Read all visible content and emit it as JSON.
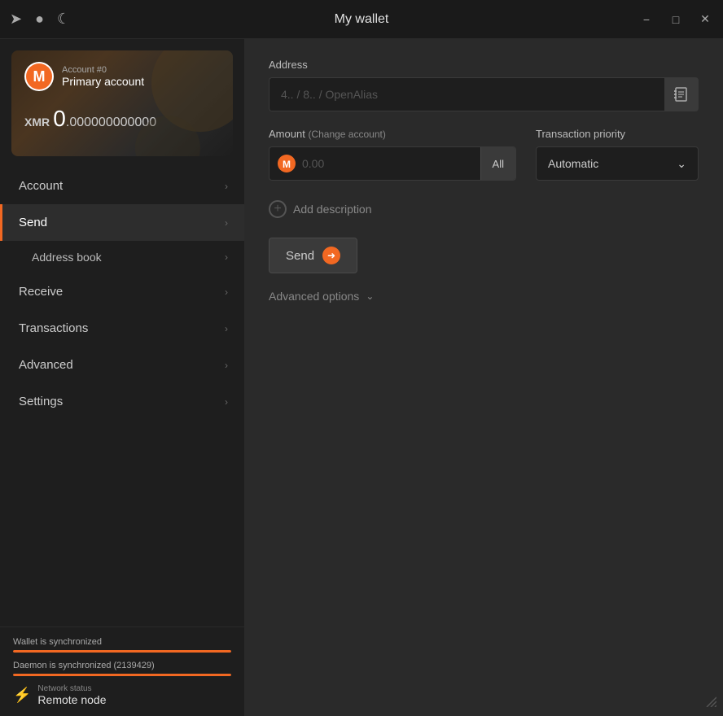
{
  "titlebar": {
    "title": "My wallet",
    "icon_forward": "→",
    "icon_globe": "🌐",
    "icon_moon": "🌙",
    "min_label": "−",
    "max_label": "□",
    "close_label": "✕"
  },
  "account_card": {
    "account_number": "Account #0",
    "account_name": "Primary account",
    "balance_label": "XMR",
    "balance_whole": "0",
    "balance_decimals": ".000000000000"
  },
  "nav": {
    "items": [
      {
        "label": "Account",
        "active": false,
        "sub": []
      },
      {
        "label": "Send",
        "active": true,
        "sub": [
          {
            "label": "Address book"
          }
        ]
      },
      {
        "label": "Receive",
        "active": false,
        "sub": []
      },
      {
        "label": "Transactions",
        "active": false,
        "sub": []
      },
      {
        "label": "Advanced",
        "active": false,
        "sub": []
      },
      {
        "label": "Settings",
        "active": false,
        "sub": []
      }
    ]
  },
  "status": {
    "wallet_sync_label": "Wallet is synchronized",
    "daemon_sync_label": "Daemon is synchronized (2139429)",
    "wallet_fill_pct": 100,
    "daemon_fill_pct": 100,
    "network_label": "Network status",
    "network_value": "Remote node"
  },
  "content": {
    "address_label": "Address",
    "address_placeholder": "4.. / 8.. / OpenAlias",
    "address_book_icon": "📋",
    "amount_label": "Amount",
    "change_account_label": "(Change account)",
    "amount_placeholder": "0.00",
    "all_button": "All",
    "priority_label": "Transaction priority",
    "priority_value": "Automatic",
    "add_description_label": "Add description",
    "send_button_label": "Send",
    "advanced_options_label": "Advanced options"
  }
}
